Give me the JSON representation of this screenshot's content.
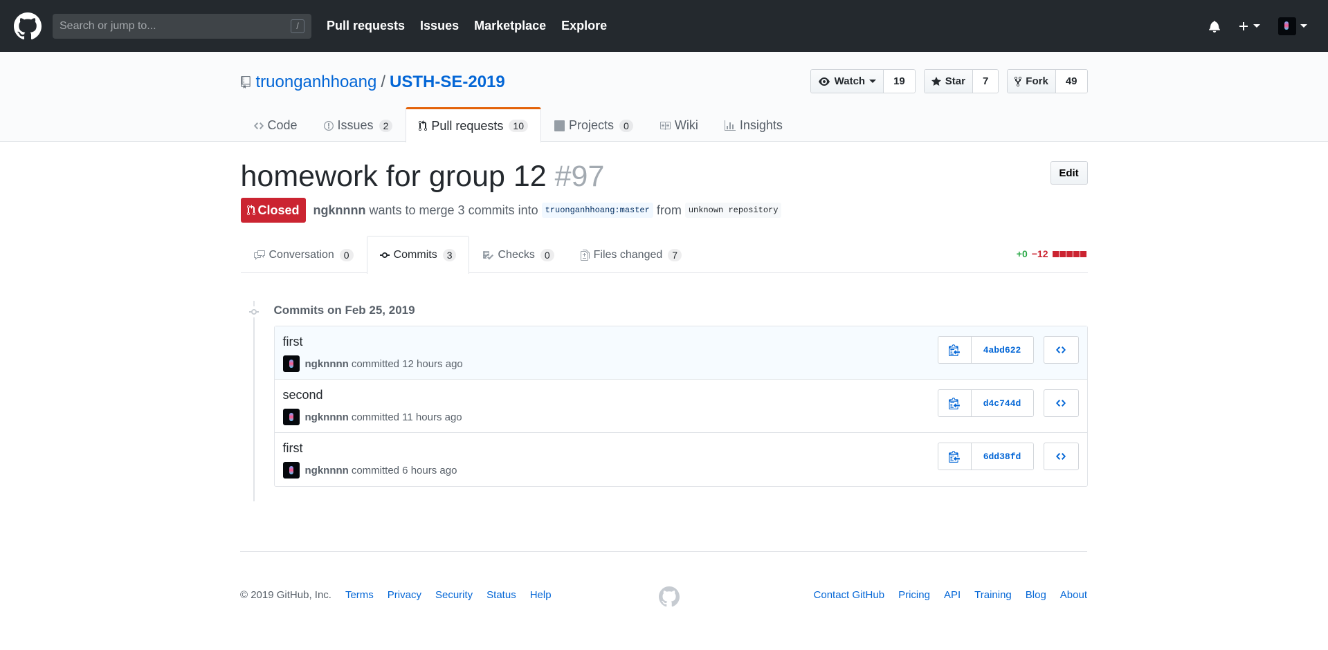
{
  "header": {
    "search_placeholder": "Search or jump to...",
    "search_shortcut": "/",
    "nav": [
      "Pull requests",
      "Issues",
      "Marketplace",
      "Explore"
    ]
  },
  "repo": {
    "owner": "truonganhhoang",
    "separator": "/",
    "name": "USTH-SE-2019",
    "watch_label": "Watch",
    "watch_count": "19",
    "star_label": "Star",
    "star_count": "7",
    "fork_label": "Fork",
    "fork_count": "49",
    "tabs": [
      {
        "label": "Code",
        "count": ""
      },
      {
        "label": "Issues",
        "count": "2"
      },
      {
        "label": "Pull requests",
        "count": "10"
      },
      {
        "label": "Projects",
        "count": "0"
      },
      {
        "label": "Wiki",
        "count": ""
      },
      {
        "label": "Insights",
        "count": ""
      }
    ]
  },
  "pr": {
    "title": "homework for group 12",
    "number": "#97",
    "edit_label": "Edit",
    "state": "Closed",
    "author": "ngknnnn",
    "merge_text": "wants to merge 3 commits into",
    "base_ref": "truonganhhoang:master",
    "from_text": "from",
    "head_ref": "unknown repository",
    "tabs": [
      {
        "label": "Conversation",
        "count": "0"
      },
      {
        "label": "Commits",
        "count": "3"
      },
      {
        "label": "Checks",
        "count": "0"
      },
      {
        "label": "Files changed",
        "count": "7"
      }
    ],
    "additions": "+0",
    "deletions": "−12"
  },
  "commits": {
    "group_title": "Commits on Feb 25, 2019",
    "items": [
      {
        "message": "first",
        "author": "ngknnnn",
        "time": "committed 12 hours ago",
        "sha": "4abd622"
      },
      {
        "message": "second",
        "author": "ngknnnn",
        "time": "committed 11 hours ago",
        "sha": "d4c744d"
      },
      {
        "message": "first",
        "author": "ngknnnn",
        "time": "committed 6 hours ago",
        "sha": "6dd38fd"
      }
    ]
  },
  "footer": {
    "copyright": "© 2019 GitHub, Inc.",
    "left_links": [
      "Terms",
      "Privacy",
      "Security",
      "Status",
      "Help"
    ],
    "right_links": [
      "Contact GitHub",
      "Pricing",
      "API",
      "Training",
      "Blog",
      "About"
    ]
  },
  "colors": {
    "header_bg": "#24292e",
    "link": "#0366d6",
    "closed": "#cb2431",
    "tab_accent": "#e36209",
    "additions": "#28a745"
  }
}
